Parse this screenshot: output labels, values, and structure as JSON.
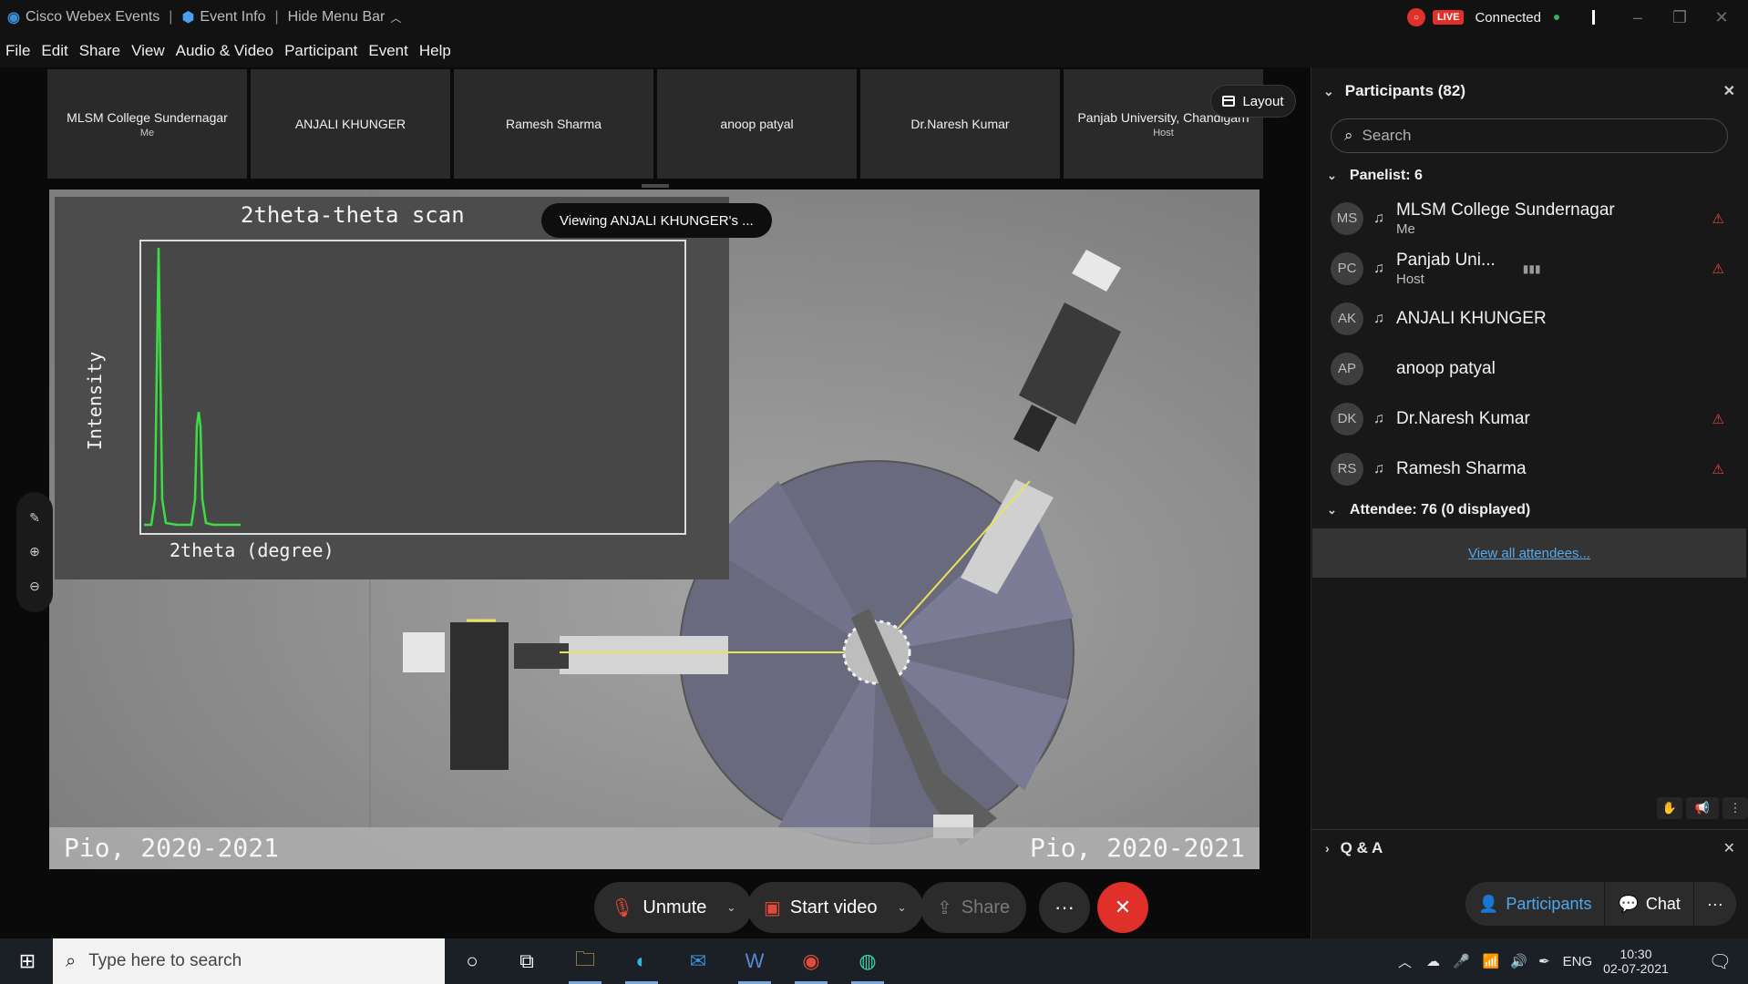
{
  "titlebar": {
    "app_name": "Cisco Webex Events",
    "event_info": "Event Info",
    "hide_menu": "Hide Menu Bar",
    "live_badge": "LIVE",
    "status": "Connected"
  },
  "menu": [
    "File",
    "Edit",
    "Share",
    "View",
    "Audio & Video",
    "Participant",
    "Event",
    "Help"
  ],
  "thumbnails": [
    {
      "name": "MLSM College Sundernagar",
      "sub": "Me"
    },
    {
      "name": "ANJALI KHUNGER",
      "sub": ""
    },
    {
      "name": "Ramesh Sharma",
      "sub": ""
    },
    {
      "name": "anoop patyal",
      "sub": ""
    },
    {
      "name": "Dr.Naresh Kumar",
      "sub": ""
    },
    {
      "name": "Panjab University, Chandigarh",
      "sub": "Host"
    }
  ],
  "layout_label": "Layout",
  "viewing_label": "Viewing ANJALI KHUNGER's ...",
  "shared_content": {
    "plot_title": "2theta-theta scan",
    "ylabel": "Intensity",
    "xlabel": "2theta (degree)",
    "watermark_left": "Pio, 2020-2021",
    "watermark_right": "Pio, 2020-2021"
  },
  "controls": {
    "unmute": "Unmute",
    "start_video": "Start video",
    "share": "Share",
    "more": "···"
  },
  "panel": {
    "title": "Participants (82)",
    "search_placeholder": "Search",
    "panelist_header": "Panelist: 6",
    "panelists": [
      {
        "initials": "MS",
        "name": "MLSM College Sundernagar",
        "role": "Me",
        "muted": true
      },
      {
        "initials": "PC",
        "name": "Panjab Uni...",
        "role": "Host",
        "muted": true
      },
      {
        "initials": "AK",
        "name": "ANJALI KHUNGER",
        "role": "",
        "muted": false
      },
      {
        "initials": "AP",
        "name": "anoop patyal",
        "role": "",
        "muted": false
      },
      {
        "initials": "DK",
        "name": "Dr.Naresh Kumar",
        "role": "",
        "muted": true
      },
      {
        "initials": "RS",
        "name": "Ramesh Sharma",
        "role": "",
        "muted": true
      }
    ],
    "attendee_header": "Attendee: 76 (0 displayed)",
    "view_all": "View all attendees...",
    "qa_title": "Q & A",
    "tabs": {
      "participants": "Participants",
      "chat": "Chat",
      "more": "···"
    }
  },
  "taskbar": {
    "search_placeholder": "Type here to search",
    "lang": "ENG",
    "time": "10:30",
    "date": "02-07-2021"
  }
}
